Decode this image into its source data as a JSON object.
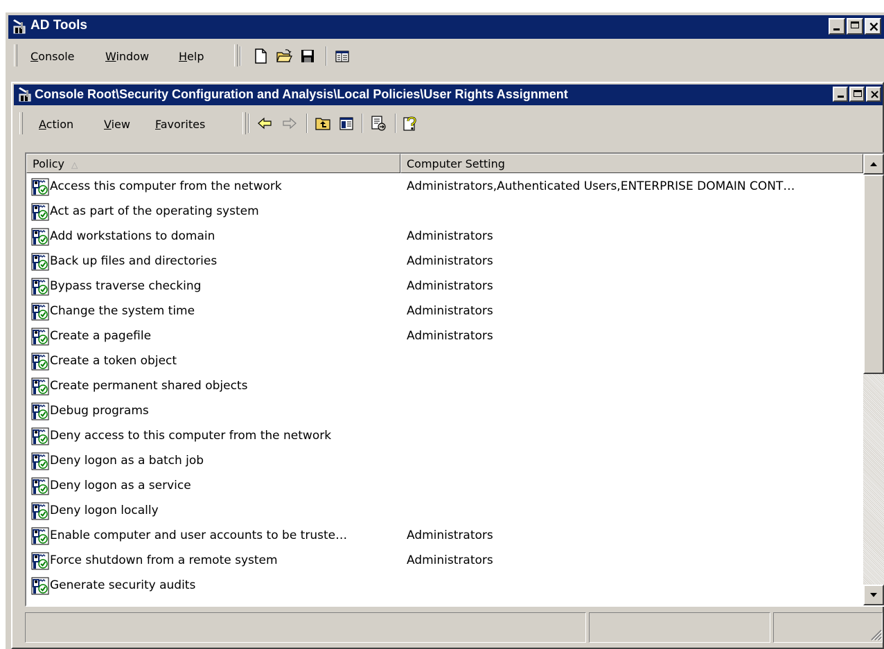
{
  "app": {
    "title": "AD Tools",
    "menu": [
      {
        "key": "C",
        "rest": "onsole"
      },
      {
        "key": "W",
        "rest": "indow"
      },
      {
        "key": "H",
        "rest": "elp"
      }
    ],
    "toolbar_icons": [
      "new-document-icon",
      "open-folder-icon",
      "save-icon",
      "show-hide-console-tree-icon"
    ]
  },
  "child_window": {
    "title": "Console Root\\Security Configuration and Analysis\\Local Policies\\User Rights Assignment",
    "menu": [
      {
        "key": "A",
        "rest": "ction"
      },
      {
        "key": "V",
        "rest": "iew"
      },
      {
        "key": "F",
        "rest": "avorites"
      }
    ],
    "toolbar_icons": [
      "back-arrow-icon",
      "forward-arrow-icon",
      "up-one-level-icon",
      "show-hide-tree-icon",
      "export-list-icon",
      "help-icon"
    ]
  },
  "list": {
    "columns": [
      "Policy",
      "Computer Setting"
    ],
    "sort_indicator": "△",
    "rows": [
      {
        "policy": "Access this computer from the network",
        "setting": "Administrators,Authenticated Users,ENTERPRISE DOMAIN CONT…"
      },
      {
        "policy": "Act as part of the operating system",
        "setting": ""
      },
      {
        "policy": "Add workstations to domain",
        "setting": "Administrators"
      },
      {
        "policy": "Back up files and directories",
        "setting": "Administrators"
      },
      {
        "policy": "Bypass traverse checking",
        "setting": "Administrators"
      },
      {
        "policy": "Change the system time",
        "setting": "Administrators"
      },
      {
        "policy": "Create a pagefile",
        "setting": "Administrators"
      },
      {
        "policy": "Create a token object",
        "setting": ""
      },
      {
        "policy": "Create permanent shared objects",
        "setting": ""
      },
      {
        "policy": "Debug programs",
        "setting": ""
      },
      {
        "policy": "Deny access to this computer from the network",
        "setting": ""
      },
      {
        "policy": "Deny logon as a batch job",
        "setting": ""
      },
      {
        "policy": "Deny logon as a service",
        "setting": ""
      },
      {
        "policy": "Deny logon locally",
        "setting": ""
      },
      {
        "policy": "Enable computer and user accounts to be truste…",
        "setting": "Administrators"
      },
      {
        "policy": "Force shutdown from a remote system",
        "setting": "Administrators"
      },
      {
        "policy": "Generate security audits",
        "setting": ""
      }
    ]
  },
  "colors": {
    "titlebar": "#0a246a",
    "face": "#d4d0c8"
  }
}
